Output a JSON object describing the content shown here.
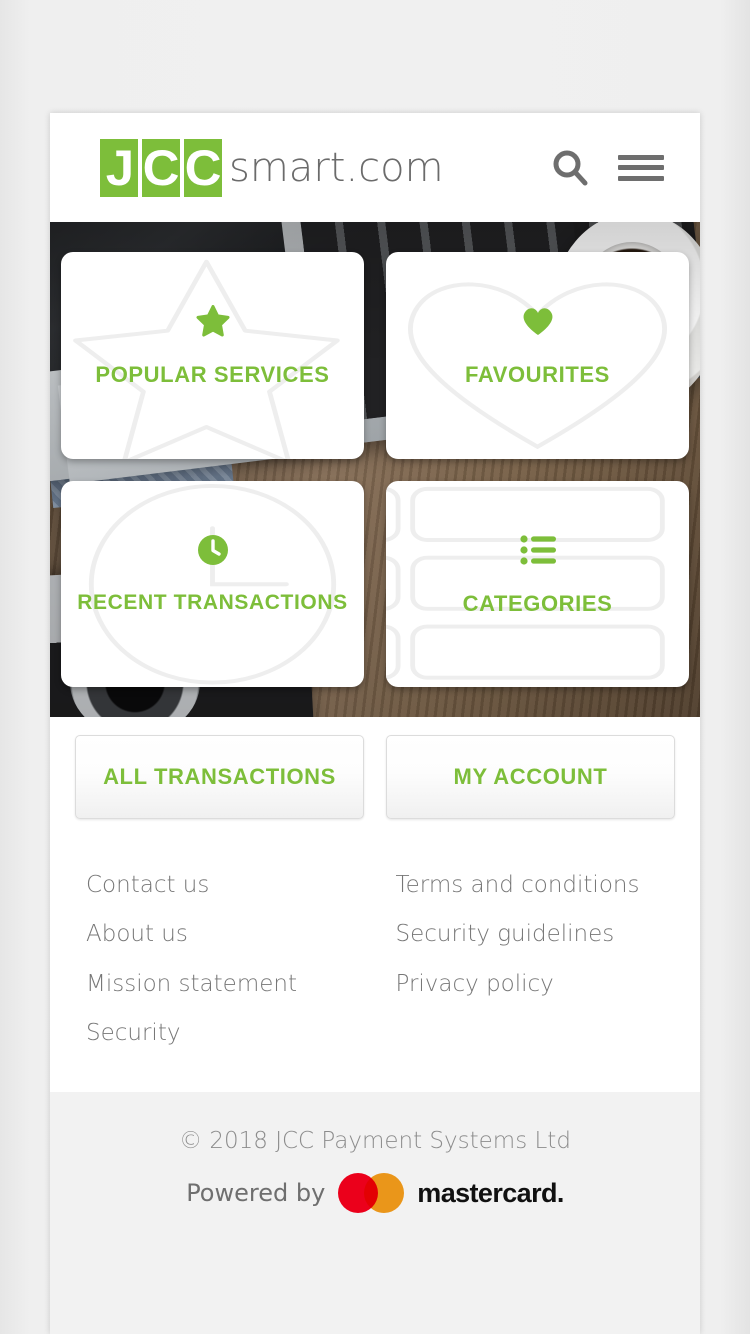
{
  "header": {
    "logo": {
      "boxes": [
        "J",
        "C",
        "C"
      ],
      "suffix": "smart.com",
      "green": "#7dbe3a"
    },
    "search_icon": "search-icon",
    "menu_icon": "hamburger-menu-icon"
  },
  "hero": {
    "tiles": [
      {
        "id": "popular-services",
        "label": "POPULAR SERVICES",
        "icon": "star-icon"
      },
      {
        "id": "favourites",
        "label": "FAVOURITES",
        "icon": "heart-icon"
      },
      {
        "id": "recent-transactions",
        "label": "RECENT TRANSACTIONS",
        "icon": "clock-icon"
      },
      {
        "id": "categories",
        "label": "CATEGORIES",
        "icon": "list-icon"
      }
    ]
  },
  "actions": [
    {
      "id": "all-transactions",
      "label": "ALL TRANSACTIONS"
    },
    {
      "id": "my-account",
      "label": "MY ACCOUNT"
    }
  ],
  "footer": {
    "column_left": [
      "Contact us",
      "About us",
      "Mission statement",
      "Security"
    ],
    "column_right": [
      "Terms and conditions",
      "Security guidelines",
      "Privacy policy"
    ],
    "copyright": "© 2018 JCC Payment Systems Ltd",
    "powered_by": "Powered by",
    "brand": "mastercard.",
    "brand_colors": {
      "red": "#EB001B",
      "yellow": "#F79E1B"
    }
  }
}
